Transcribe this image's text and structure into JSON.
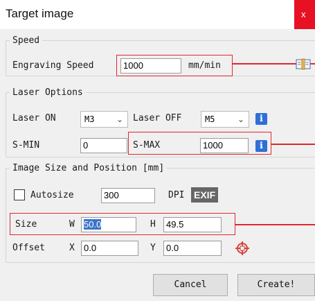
{
  "window": {
    "title": "Target image",
    "close_glyph": "x"
  },
  "speed": {
    "legend": "Speed",
    "engraving_label": "Engraving Speed",
    "engraving_value": "1000",
    "unit": "mm/min",
    "help_icon": "book-icon"
  },
  "laser": {
    "legend": "Laser Options",
    "on_label": "Laser ON",
    "on_value": "M3",
    "off_label": "Laser OFF",
    "off_value": "M5",
    "smin_label": "S-MIN",
    "smin_value": "0",
    "smax_label": "S-MAX",
    "smax_value": "1000",
    "info_glyph": "i"
  },
  "image": {
    "legend": "Image Size and Position [mm]",
    "autosize_label": "Autosize",
    "autosize_checked": false,
    "dpi_value": "300",
    "dpi_label": "DPI",
    "exif_label": "EXIF",
    "size_label": "Size",
    "w_label": "W",
    "w_value": "50.0",
    "h_label": "H",
    "h_value": "49.5",
    "offset_label": "Offset",
    "x_label": "X",
    "x_value": "0.0",
    "y_label": "Y",
    "y_value": "0.0",
    "center_icon": "crosshair-icon"
  },
  "buttons": {
    "cancel": "Cancel",
    "create": "Create!"
  },
  "colors": {
    "annotation_red": "#e0262e",
    "info_blue": "#2f6fd8",
    "selection_blue": "#3a73c8"
  }
}
